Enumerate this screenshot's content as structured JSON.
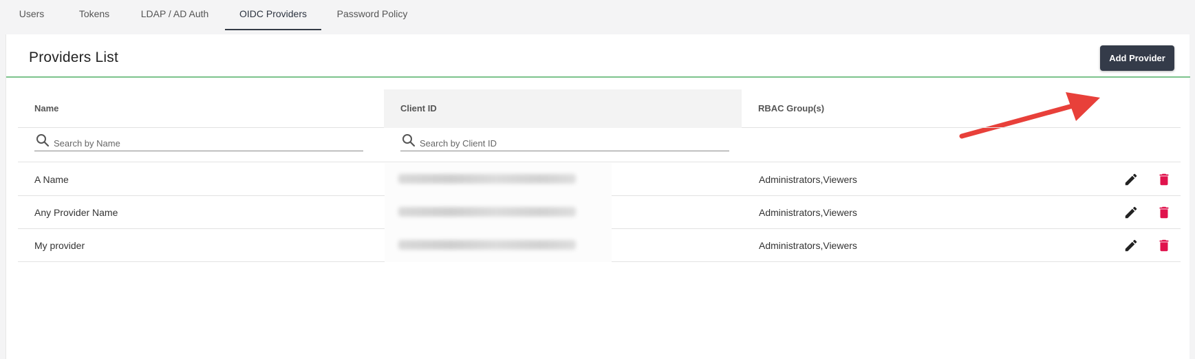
{
  "tabs": [
    {
      "label": "Users",
      "active": false
    },
    {
      "label": "Tokens",
      "active": false
    },
    {
      "label": "LDAP / AD Auth",
      "active": false
    },
    {
      "label": "OIDC Providers",
      "active": true
    },
    {
      "label": "Password Policy",
      "active": false
    }
  ],
  "panel": {
    "title": "Providers List",
    "add_button_label": "Add Provider"
  },
  "table": {
    "columns": [
      "Name",
      "Client ID",
      "RBAC Group(s)"
    ],
    "filters": {
      "name_placeholder": "Search by Name",
      "client_id_placeholder": "Search by Client ID"
    },
    "rows": [
      {
        "name": "A Name",
        "client_id": "",
        "rbac_groups": "Administrators,Viewers"
      },
      {
        "name": "Any Provider Name",
        "client_id": "",
        "rbac_groups": "Administrators,Viewers"
      },
      {
        "name": "My provider",
        "client_id": "",
        "rbac_groups": "Administrators,Viewers"
      }
    ]
  },
  "icons": {
    "search": "search-icon",
    "edit": "pencil-icon",
    "delete": "trash-icon",
    "annotation": "red-arrow-icon"
  },
  "colors": {
    "primary_button": "#343b49",
    "header_underline": "#7cc38c",
    "delete_icon": "#e0134d",
    "annotation_arrow": "#e8403a"
  }
}
